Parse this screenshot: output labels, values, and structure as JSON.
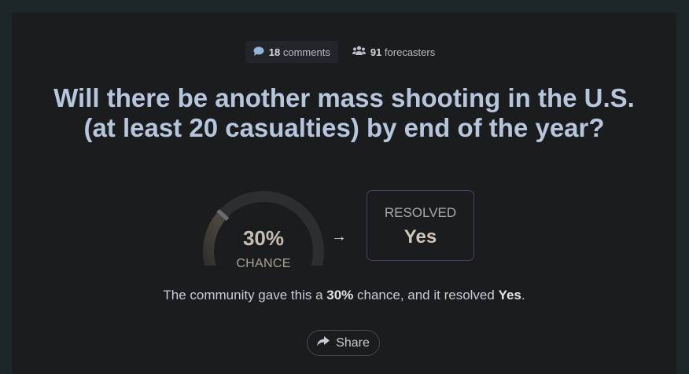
{
  "meta": {
    "comments_count": "18",
    "comments_label": "comments",
    "forecasters_count": "91",
    "forecasters_label": "forecasters"
  },
  "question": {
    "title": "Will there be another mass shooting in the U.S. (at least 20 casualties) by end of the year?"
  },
  "forecast": {
    "probability": 0.3,
    "percent_label": "30%",
    "chance_label": "CHANCE",
    "arrow": "→"
  },
  "resolution": {
    "label": "RESOLVED",
    "value": "Yes"
  },
  "summary": {
    "prefix": "The community gave this a ",
    "percent": "30%",
    "middle": " chance, and it resolved ",
    "outcome": "Yes",
    "suffix": "."
  },
  "share": {
    "label": "Share"
  },
  "icons": {
    "comments": "speech-bubble-icon",
    "forecasters": "people-icon",
    "share": "share-arrow-icon"
  },
  "colors": {
    "page_bg": "#1c2626",
    "card_bg": "#1b1c1e",
    "title": "#b6c6dc",
    "gauge_track": "#2c2e30",
    "gauge_fill": "#4a463e",
    "gauge_needle": "#6a6e73",
    "resolved_border": "#4e3f6a"
  }
}
